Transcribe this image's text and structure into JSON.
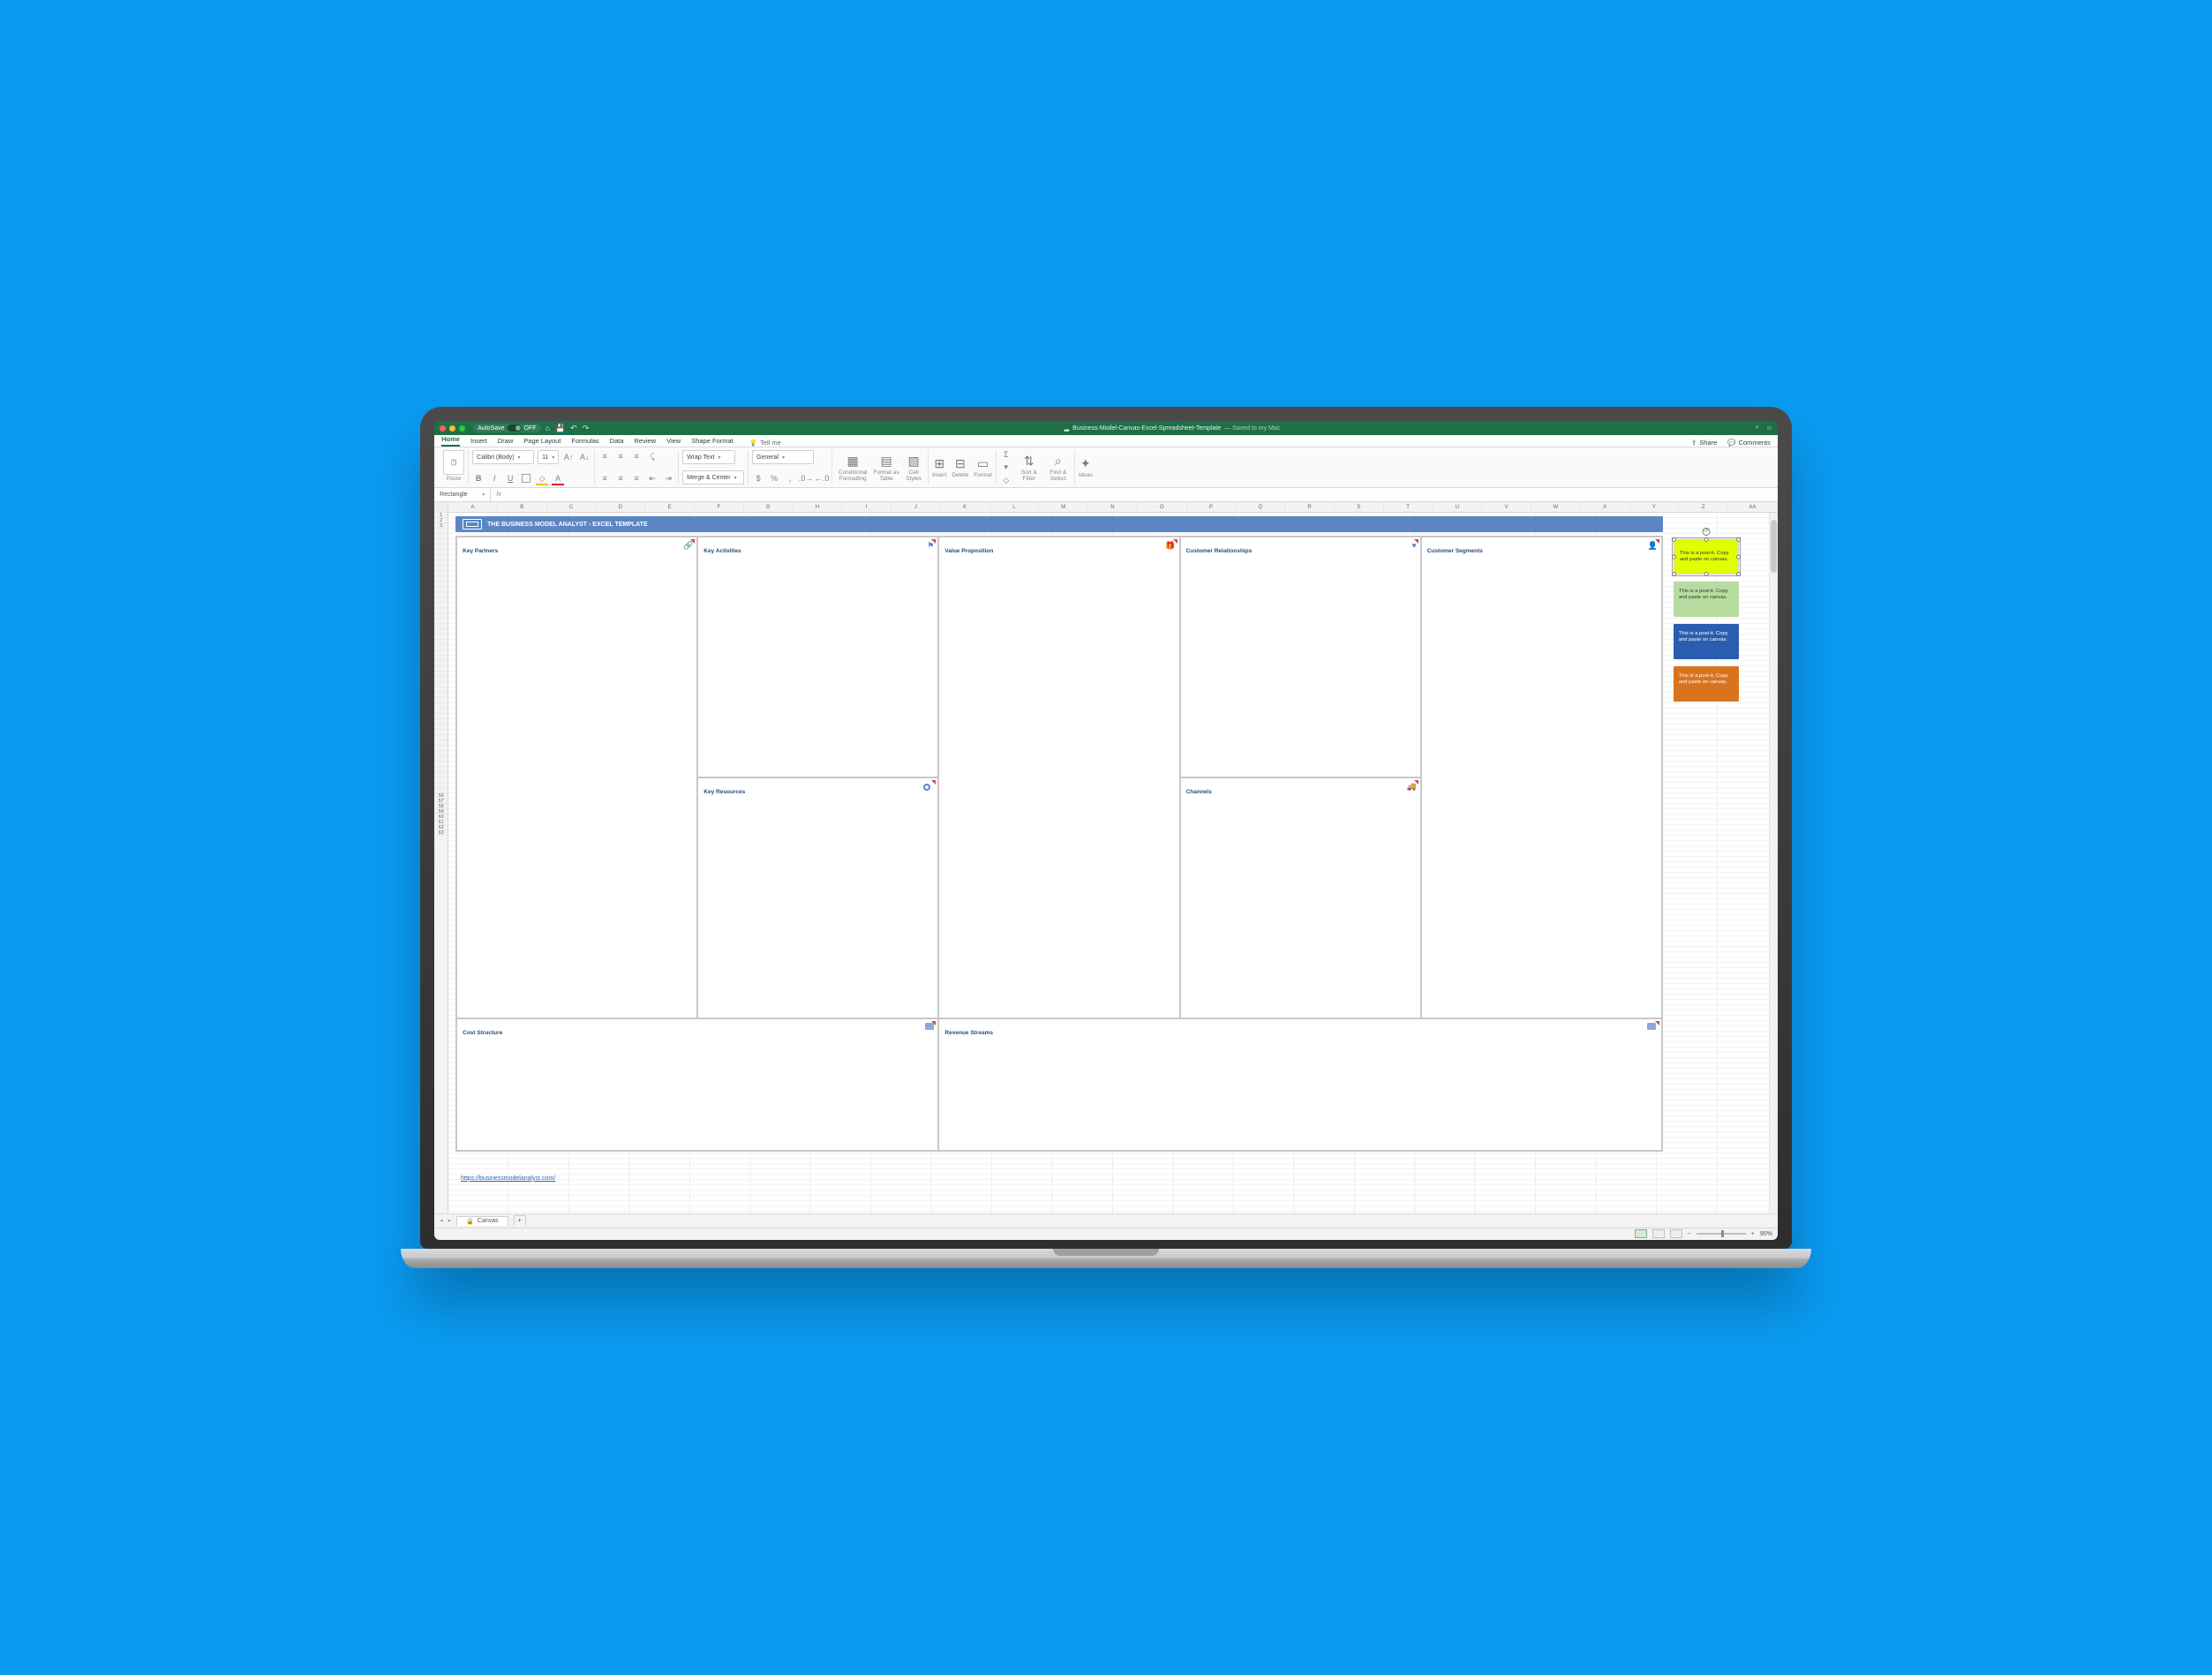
{
  "titlebar": {
    "autosave_label": "AutoSave",
    "autosave_state": "OFF",
    "doc_title": "Business-Model-Canvas-Excel-Spreadsheet-Template",
    "doc_suffix": "— Saved to my Mac"
  },
  "tabs": {
    "items": [
      "Home",
      "Insert",
      "Draw",
      "Page Layout",
      "Formulas",
      "Data",
      "Review",
      "View",
      "Shape Format"
    ],
    "active": "Home",
    "tell_me": "Tell me",
    "share": "Share",
    "comments": "Comments"
  },
  "ribbon": {
    "paste": "Paste",
    "font_name": "Calibri (Body)",
    "font_size": "11",
    "wrap": "Wrap Text",
    "merge": "Merge & Center",
    "number_format": "General",
    "cond": "Conditional Formatting",
    "table": "Format as Table",
    "styles": "Cell Styles",
    "insert": "Insert",
    "delete": "Delete",
    "format": "Format",
    "sort": "Sort & Filter",
    "find": "Find & Select",
    "ideas": "Ideas"
  },
  "namebox": {
    "value": "Rectangle",
    "fx": "fx"
  },
  "columns": [
    "A",
    "B",
    "C",
    "D",
    "E",
    "F",
    "G",
    "H",
    "I",
    "J",
    "K",
    "L",
    "M",
    "N",
    "O",
    "P",
    "Q",
    "R",
    "S",
    "T",
    "U",
    "V",
    "W",
    "X",
    "Y",
    "Z",
    "AA"
  ],
  "row_labels": [
    "1",
    "2",
    "3",
    "",
    "",
    "",
    "",
    "",
    "",
    "",
    "",
    "",
    "",
    "",
    "",
    "",
    "",
    "",
    "",
    "",
    "",
    "",
    "",
    "",
    "",
    "",
    "",
    "",
    "",
    "",
    "",
    "",
    "",
    "",
    "",
    "",
    "",
    "",
    "",
    "",
    "",
    "",
    "",
    "",
    "",
    "",
    "",
    "",
    "",
    "",
    "",
    "",
    "",
    "56",
    "57",
    "58",
    "59",
    "60",
    "61",
    "62",
    "63"
  ],
  "banner": "THE BUSINESS MODEL ANALYST - EXCEL TEMPLATE",
  "canvas": {
    "kp": "Key Partners",
    "ka": "Key Activities",
    "kr": "Key Resources",
    "vp": "Value Proposition",
    "cr": "Customer Relationships",
    "ch": "Channels",
    "cs": "Customer Segments",
    "cost": "Cost Structure",
    "rev": "Revenue Streams"
  },
  "postit_text": "This is a post-it. Copy and paste on canvas.",
  "link": "https://businessmodelanalyst.com/",
  "sheet": {
    "name": "Canvas"
  },
  "status": {
    "zoom": "90%"
  }
}
